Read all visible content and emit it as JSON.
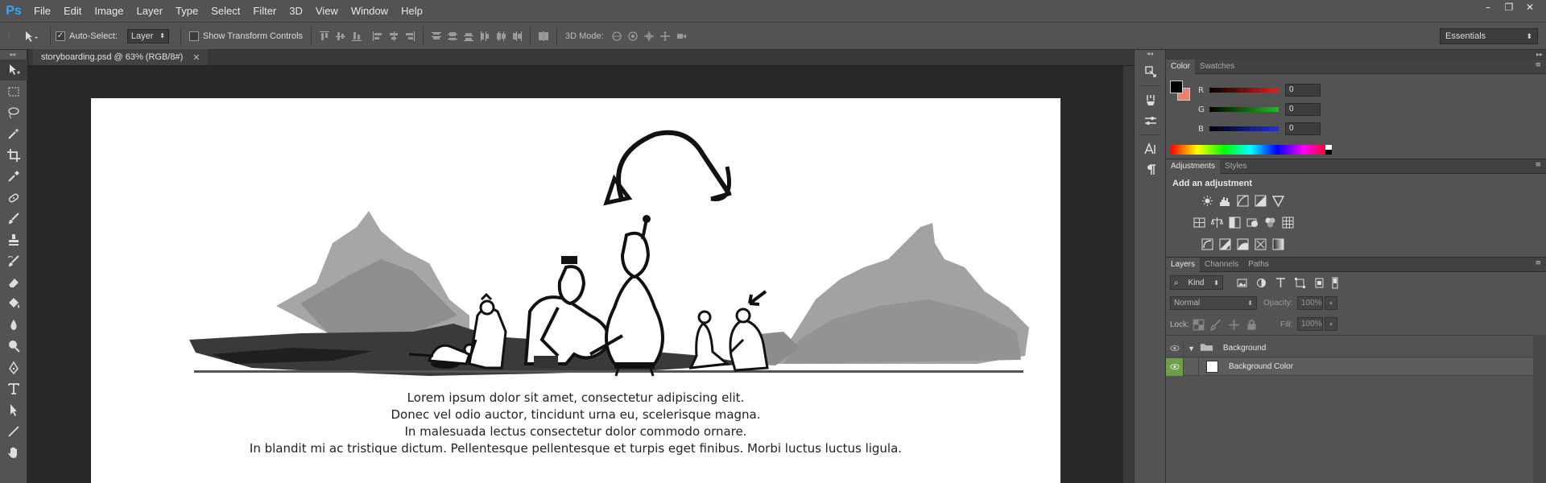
{
  "app": {
    "logo": "Ps"
  },
  "menu": [
    "File",
    "Edit",
    "Image",
    "Layer",
    "Type",
    "Select",
    "Filter",
    "3D",
    "View",
    "Window",
    "Help"
  ],
  "window_controls": {
    "minimize": "–",
    "restore": "❐",
    "close": "✕"
  },
  "options": {
    "auto_select_label": "Auto-Select:",
    "auto_select_checked": true,
    "auto_select_value": "Layer",
    "show_transform_label": "Show Transform Controls",
    "show_transform_checked": false,
    "mode_3d_label": "3D Mode:",
    "workspace": "Essentials"
  },
  "document": {
    "tab_title": "storyboarding.psd @ 63% (RGB/8#)",
    "caption_lines": [
      "Lorem ipsum dolor sit amet, consectetur adipiscing elit.",
      "Donec vel odio auctor, tincidunt urna eu, scelerisque magna.",
      "In malesuada lectus consectetur dolor commodo ornare.",
      "In blandit mi ac tristique dictum. Pellentesque pellentesque et turpis eget finibus. Morbi luctus luctus ligula."
    ]
  },
  "tools": [
    "move-tool",
    "marquee-tool",
    "lasso-tool",
    "magic-wand-tool",
    "crop-tool",
    "eyedropper-tool",
    "healing-brush-tool",
    "brush-tool",
    "clone-stamp-tool",
    "history-brush-tool",
    "eraser-tool",
    "paint-bucket-tool",
    "blur-tool",
    "dodge-tool",
    "pen-tool",
    "type-tool",
    "path-selection-tool",
    "line-tool",
    "hand-tool"
  ],
  "color_panel": {
    "tabs": [
      "Color",
      "Swatches"
    ],
    "channels": [
      {
        "label": "R",
        "value": "0",
        "color": "#d42a2a"
      },
      {
        "label": "G",
        "value": "0",
        "color": "#2ab82a"
      },
      {
        "label": "B",
        "value": "0",
        "color": "#2a3ad4"
      }
    ],
    "foreground": "#000000",
    "background": "#e8826a"
  },
  "adjustments_panel": {
    "tabs": [
      "Adjustments",
      "Styles"
    ],
    "heading": "Add an adjustment"
  },
  "layers_panel": {
    "tabs": [
      "Layers",
      "Channels",
      "Paths"
    ],
    "kind_label": "Kind",
    "blend_mode": "Normal",
    "opacity_label": "Opacity:",
    "opacity_value": "100%",
    "lock_label": "Lock:",
    "fill_label": "Fill:",
    "fill_value": "100%",
    "layers": [
      {
        "name": "Background",
        "type": "group"
      },
      {
        "name": "Background Color",
        "type": "layer"
      }
    ]
  }
}
